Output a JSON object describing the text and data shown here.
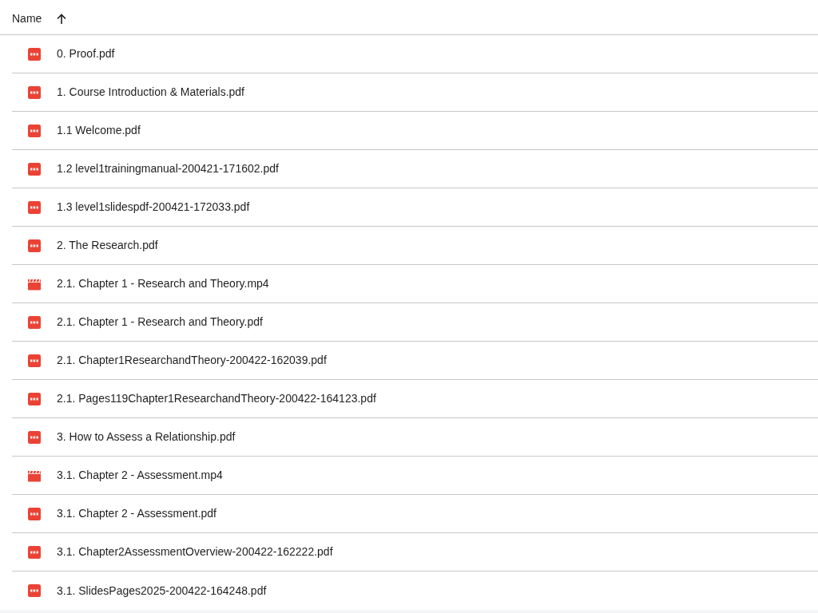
{
  "header": {
    "column_label": "Name",
    "sort_ascending": true
  },
  "files": [
    {
      "name": "0. Proof.pdf",
      "kind": "pdf"
    },
    {
      "name": "1. Course Introduction & Materials.pdf",
      "kind": "pdf"
    },
    {
      "name": "1.1 Welcome.pdf",
      "kind": "pdf"
    },
    {
      "name": "1.2 level1trainingmanual-200421-171602.pdf",
      "kind": "pdf"
    },
    {
      "name": "1.3 level1slidespdf-200421-172033.pdf",
      "kind": "pdf"
    },
    {
      "name": "2. The Research.pdf",
      "kind": "pdf"
    },
    {
      "name": "2.1. Chapter 1 - Research and Theory.mp4",
      "kind": "video"
    },
    {
      "name": "2.1. Chapter 1 - Research and Theory.pdf",
      "kind": "pdf"
    },
    {
      "name": "2.1. Chapter1ResearchandTheory-200422-162039.pdf",
      "kind": "pdf"
    },
    {
      "name": "2.1. Pages119Chapter1ResearchandTheory-200422-164123.pdf",
      "kind": "pdf"
    },
    {
      "name": "3. How to Assess a Relationship.pdf",
      "kind": "pdf"
    },
    {
      "name": "3.1. Chapter 2 - Assessment.mp4",
      "kind": "video"
    },
    {
      "name": "3.1. Chapter 2 - Assessment.pdf",
      "kind": "pdf"
    },
    {
      "name": "3.1. Chapter2AssessmentOverview-200422-162222.pdf",
      "kind": "pdf"
    },
    {
      "name": "3.1. SlidesPages2025-200422-164248.pdf",
      "kind": "pdf"
    }
  ]
}
